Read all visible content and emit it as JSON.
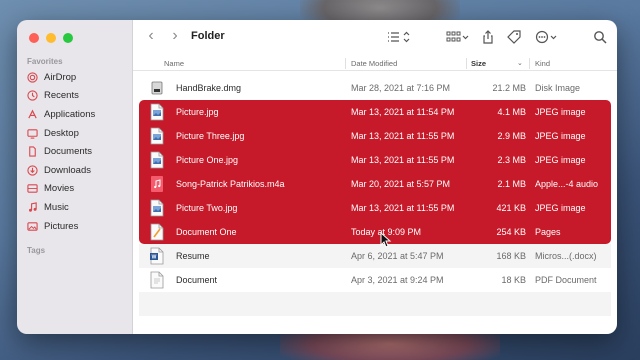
{
  "window": {
    "title": "Folder"
  },
  "sidebar": {
    "favorites_label": "Favorites",
    "tags_label": "Tags",
    "items": [
      {
        "label": "AirDrop",
        "icon": "airdrop-icon"
      },
      {
        "label": "Recents",
        "icon": "clock-icon"
      },
      {
        "label": "Applications",
        "icon": "applications-icon"
      },
      {
        "label": "Desktop",
        "icon": "desktop-icon"
      },
      {
        "label": "Documents",
        "icon": "document-icon"
      },
      {
        "label": "Downloads",
        "icon": "download-icon"
      },
      {
        "label": "Movies",
        "icon": "film-icon"
      },
      {
        "label": "Music",
        "icon": "music-icon"
      },
      {
        "label": "Pictures",
        "icon": "pictures-icon"
      }
    ]
  },
  "columns": {
    "name": "Name",
    "date": "Date Modified",
    "size": "Size",
    "kind": "Kind"
  },
  "files": [
    {
      "name": "HandBrake.dmg",
      "date": "Mar 28, 2021 at 7:16 PM",
      "size": "21.2 MB",
      "kind": "Disk Image",
      "icon": "disk-image-icon",
      "selected": false
    },
    {
      "name": "Picture.jpg",
      "date": "Mar 13, 2021 at 11:54 PM",
      "size": "4.1 MB",
      "kind": "JPEG image",
      "icon": "jpeg-file-icon",
      "selected": true
    },
    {
      "name": "Picture Three.jpg",
      "date": "Mar 13, 2021 at 11:55 PM",
      "size": "2.9 MB",
      "kind": "JPEG image",
      "icon": "jpeg-file-icon",
      "selected": true
    },
    {
      "name": "Picture One.jpg",
      "date": "Mar 13, 2021 at 11:55 PM",
      "size": "2.3 MB",
      "kind": "JPEG image",
      "icon": "jpeg-file-icon",
      "selected": true
    },
    {
      "name": "Song-Patrick Patrikios.m4a",
      "date": "Mar 20, 2021 at 5:57 PM",
      "size": "2.1 MB",
      "kind": "Apple...-4 audio",
      "icon": "audio-file-icon",
      "selected": true
    },
    {
      "name": "Picture Two.jpg",
      "date": "Mar 13, 2021 at 11:55 PM",
      "size": "421 KB",
      "kind": "JPEG image",
      "icon": "jpeg-file-icon",
      "selected": true
    },
    {
      "name": "Document One",
      "date": "Today at 9:09 PM",
      "size": "254 KB",
      "kind": "Pages",
      "icon": "pages-file-icon",
      "selected": true
    },
    {
      "name": "Resume",
      "date": "Apr 6, 2021 at 5:47 PM",
      "size": "168 KB",
      "kind": "Micros...(.docx)",
      "icon": "word-file-icon",
      "selected": false
    },
    {
      "name": "Document",
      "date": "Apr 3, 2021 at 9:24 PM",
      "size": "18 KB",
      "kind": "PDF Document",
      "icon": "pdf-file-icon",
      "selected": false
    }
  ],
  "colors": {
    "selection": "#c61a2a",
    "sidebar_bg": "#e8e6ea"
  }
}
